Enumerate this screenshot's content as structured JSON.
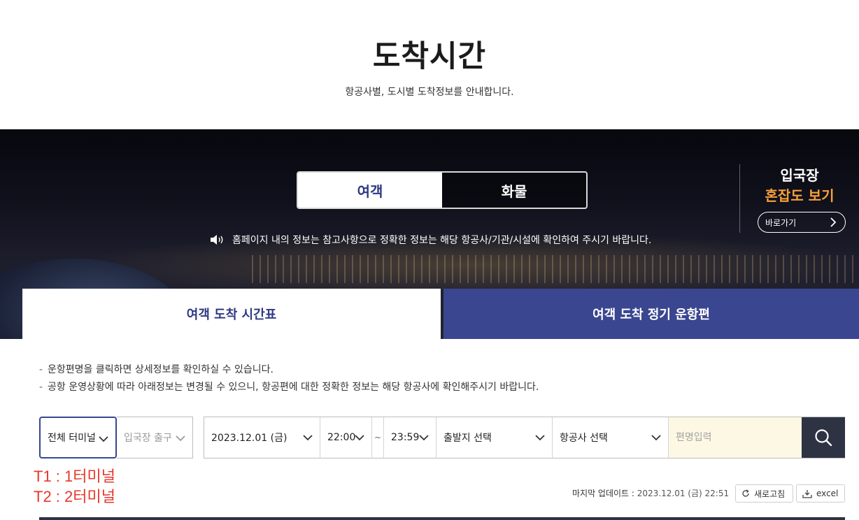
{
  "header": {
    "title": "도착시간",
    "subtitle": "항공사별, 도시별 도착정보를 안내합니다."
  },
  "mode_tabs": [
    {
      "label": "여객",
      "active": true
    },
    {
      "label": "화물",
      "active": false
    }
  ],
  "notice": {
    "icon": "speaker-icon",
    "text": "홈페이지 내의 정보는 참고사항으로 정확한 정보는 해당 항공사/기관/시설에 확인하여 주시기 바랍니다."
  },
  "congestion": {
    "line1": "입국장",
    "line2": "혼잡도 보기",
    "button_label": "바로가기"
  },
  "sub_tabs": [
    {
      "label": "여객 도착 시간표",
      "active": true
    },
    {
      "label": "여객 도착 정기 운항편",
      "active": false
    }
  ],
  "info": [
    "운항편명을 클릭하면 상세정보를 확인하실 수 있습니다.",
    "공항 운영상황에 따라 아래정보는 변경될 수 있으니, 항공편에 대한 정확한 정보는 해당 항공사에 확인해주시기 바랍니다."
  ],
  "filters": {
    "terminal": "전체 터미널",
    "exit": "입국장 출구",
    "date": "2023.12.01 (금)",
    "time_from": "22:00",
    "time_sep": "~",
    "time_to": "23:59",
    "origin": "출발지 선택",
    "airline": "항공사 선택",
    "flight_placeholder": "편명입력"
  },
  "annotations": {
    "t1": "T1 : 1터미널",
    "t2": "T2 : 2터미널"
  },
  "update": {
    "label": "마지막 업데이트 :",
    "value": "2023.12.01 (금) 22:51"
  },
  "actions": {
    "refresh": "새로고침",
    "excel": "excel"
  },
  "colors": {
    "accent": "#3a4690",
    "highlight": "#f7a03b",
    "annotation": "#e8372c",
    "search_button": "#2d3342",
    "input_bg": "#fdf8e4"
  }
}
